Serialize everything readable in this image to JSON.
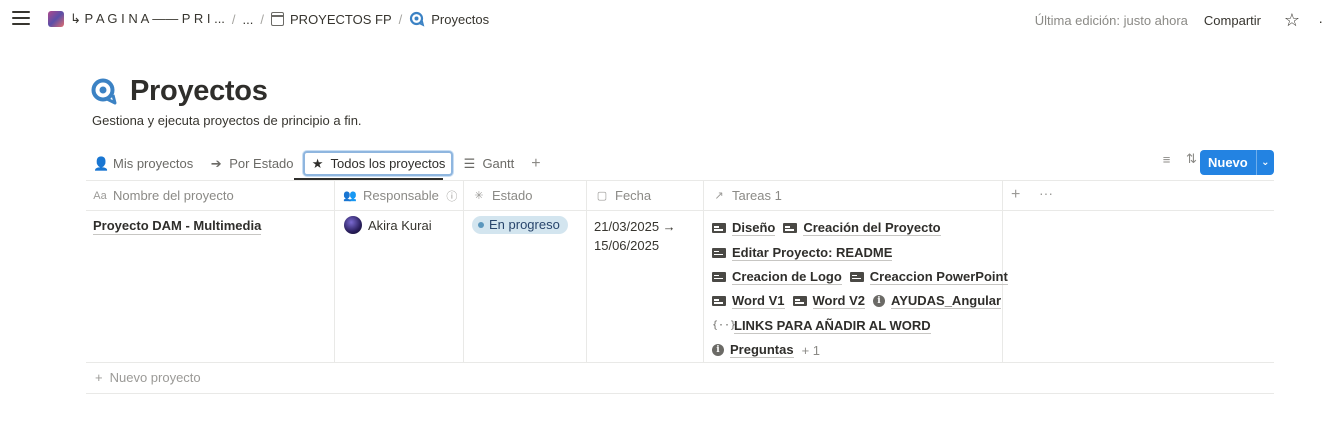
{
  "topbar": {
    "breadcrumbs": [
      {
        "label": "↳ P A G I N A —— P R I ...",
        "icon": "image-icon"
      },
      {
        "label": "..."
      },
      {
        "label": "PROYECTOS FP",
        "icon": "calendar-icon"
      },
      {
        "label": "Proyectos",
        "icon": "project-icon"
      }
    ],
    "last_edit": "Última edición: justo ahora",
    "share": "Compartir"
  },
  "header": {
    "title": "Proyectos",
    "subtitle": "Gestiona y ejecuta proyectos de principio a fin."
  },
  "views": {
    "tabs": [
      {
        "label": "Mis proyectos",
        "icon": "person-icon",
        "active": false
      },
      {
        "label": "Por Estado",
        "icon": "arrow-circle-icon",
        "active": false
      },
      {
        "label": "Todos los proyectos",
        "icon": "star-icon",
        "active": true
      },
      {
        "label": "Gantt",
        "icon": "gantt-icon",
        "active": false
      }
    ],
    "new_button": "Nuevo"
  },
  "table": {
    "columns": [
      {
        "label": "Nombre del proyecto",
        "icon": "Aa"
      },
      {
        "label": "Responsable",
        "icon": "people-icon"
      },
      {
        "label": "Estado",
        "icon": "status-icon"
      },
      {
        "label": "Fecha",
        "icon": "calendar-icon"
      },
      {
        "label": "Tareas 1",
        "icon": "relation-arrow-icon"
      }
    ],
    "rows": [
      {
        "name": "Proyecto DAM - Multimedia",
        "responsable": "Akira Kurai",
        "estado": "En progreso",
        "fecha_inicio": "21/03/2025 →",
        "fecha_fin": "15/06/2025",
        "tareas": [
          "Diseño",
          "Creación del Proyecto",
          "Editar Proyecto: README",
          "Creacion de Logo",
          "Creaccion PowerPoint",
          "Word V1",
          "Word V2",
          "AYUDAS_Angular",
          "LINKS PARA AÑADIR AL WORD",
          "Preguntas"
        ],
        "tareas_more": "+ 1"
      }
    ],
    "new_row": "Nuevo proyecto"
  },
  "colors": {
    "accent": "#2383e2",
    "status_bg": "#d3e5ef",
    "status_dot": "#5b97bd"
  }
}
